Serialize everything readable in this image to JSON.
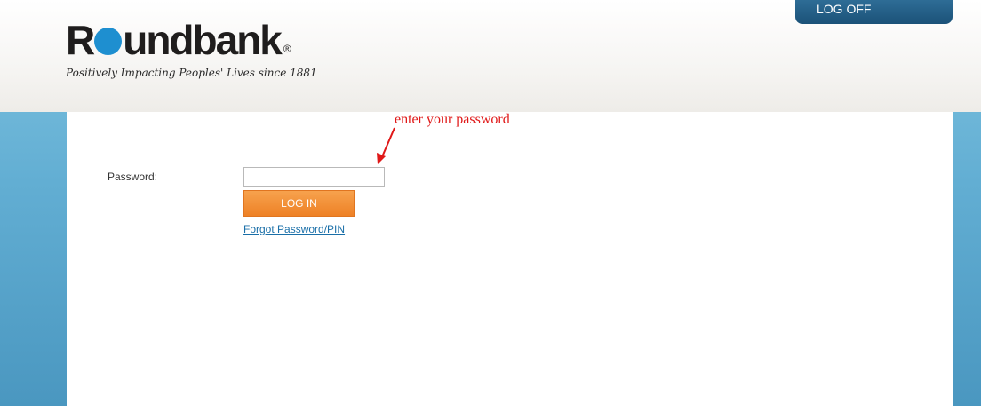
{
  "header": {
    "logo_prefix": "R",
    "logo_suffix": "undbank",
    "logo_registered": "®",
    "tagline": "Positively Impacting Peoples' Lives since 1881",
    "logoff_label": "LOG OFF"
  },
  "login_form": {
    "password_label": "Password:",
    "password_value": "",
    "login_button_label": "LOG IN",
    "forgot_link_label": "Forgot Password/PIN"
  },
  "annotation": {
    "text": "enter your password"
  },
  "colors": {
    "brand_blue": "#1e8fd0",
    "button_orange": "#ee8126",
    "header_button": "#1b5278",
    "annotation_red": "#e01818",
    "link_blue": "#1a6fa8"
  }
}
